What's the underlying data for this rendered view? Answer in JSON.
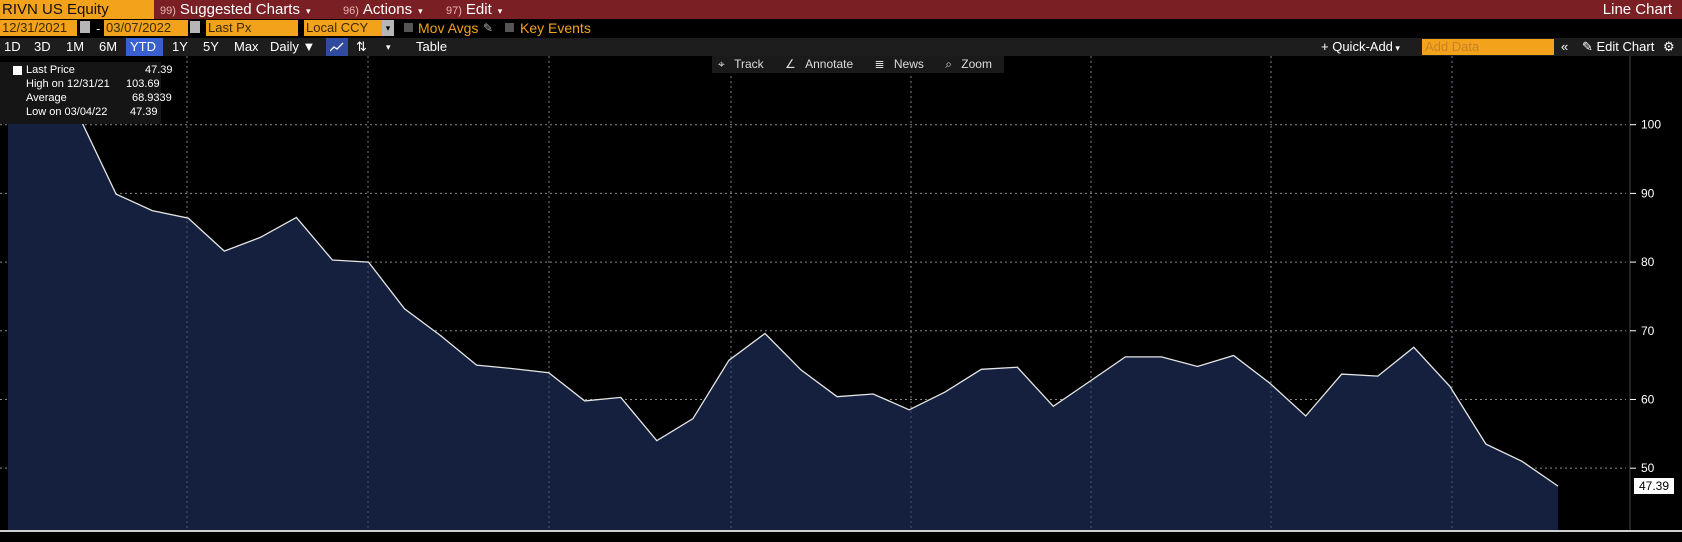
{
  "topbar": {
    "ticker": "RIVN US Equity",
    "menus": [
      {
        "num": "99)",
        "label": "Suggested Charts"
      },
      {
        "num": "96)",
        "label": "Actions"
      },
      {
        "num": "97)",
        "label": "Edit"
      }
    ],
    "chart_kind": "Line Chart"
  },
  "controls": {
    "start_date": "12/31/2021",
    "end_date": "03/07/2022",
    "field": "Last Px",
    "currency": "Local CCY",
    "mov_avgs": "Mov Avgs",
    "key_events": "Key Events"
  },
  "toolbar": {
    "ranges": [
      "1D",
      "3D",
      "1M",
      "6M",
      "YTD",
      "1Y",
      "5Y",
      "Max"
    ],
    "active_range": "YTD",
    "frequency": "Daily",
    "table": "Table",
    "quick_add": "Quick-Add",
    "add_data_placeholder": "Add Data",
    "edit_chart": "Edit Chart"
  },
  "chart_tools": [
    "Track",
    "Annotate",
    "News",
    "Zoom"
  ],
  "legend": {
    "rows": [
      {
        "label": "Last Price",
        "value": "47.39"
      },
      {
        "label": "High on 12/31/21",
        "value": "103.69"
      },
      {
        "label": "Average",
        "value": "68.9339"
      },
      {
        "label": "Low on 03/04/22",
        "value": "47.39"
      }
    ]
  },
  "colors": {
    "background": "#000000",
    "top_bar": "#7a1f23",
    "accent_orange": "#f2a31b",
    "area_fill": "#14203d",
    "line": "#e6e6e6",
    "active_tab": "#3a5fd0"
  },
  "chart_data": {
    "type": "area",
    "ylim": [
      41.0,
      110.0
    ],
    "yticks": [
      50,
      60,
      70,
      80,
      90,
      100
    ],
    "last_value_label": "47.39",
    "grid": true,
    "series": [
      {
        "values": [
          103.69,
          102.0,
          100.9,
          89.9,
          87.5,
          86.4,
          81.6,
          83.6,
          86.5,
          80.3,
          80.0,
          73.2,
          69.3,
          65.0,
          64.5,
          63.9,
          59.8,
          60.3,
          54.0,
          57.2,
          65.7,
          69.6,
          64.3,
          60.4,
          60.8,
          58.5,
          61.1,
          64.4,
          64.7,
          59.0,
          62.6,
          66.2,
          66.2,
          64.8,
          66.4,
          62.4,
          57.6,
          63.7,
          63.4,
          67.6,
          61.9,
          53.5,
          51.0,
          47.39
        ]
      }
    ]
  }
}
